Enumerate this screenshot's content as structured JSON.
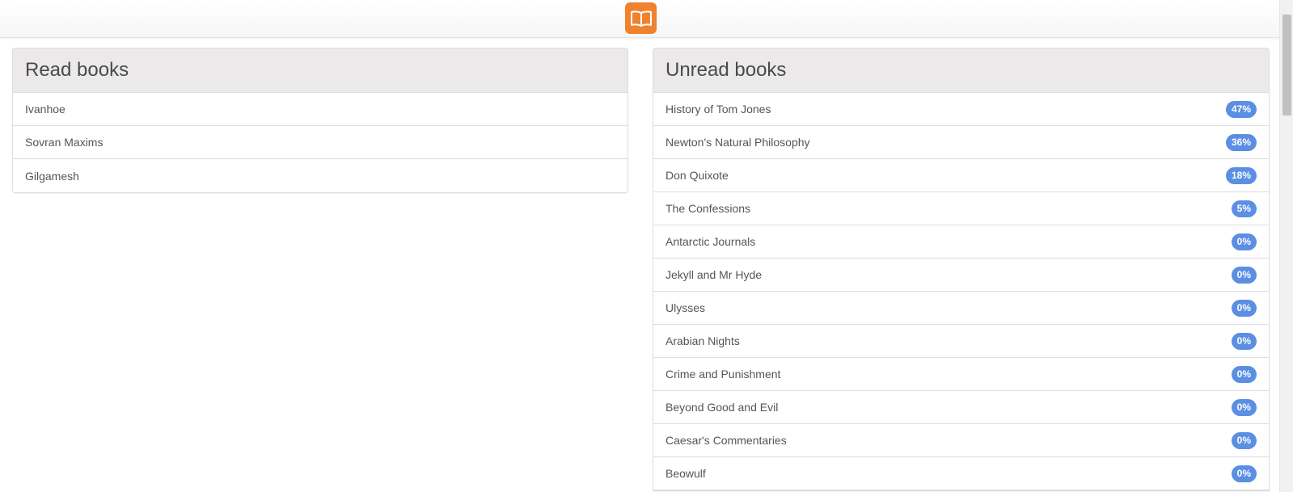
{
  "app": {
    "logo_icon": "open-book-icon",
    "accent_color": "#f0822d"
  },
  "read_panel": {
    "title": "Read books",
    "items": [
      {
        "label": "Ivanhoe"
      },
      {
        "label": "Sovran Maxims"
      },
      {
        "label": "Gilgamesh"
      }
    ]
  },
  "unread_panel": {
    "title": "Unread books",
    "badge_color": "#5b8fe3",
    "items": [
      {
        "label": "History of Tom Jones",
        "progress": "47%"
      },
      {
        "label": "Newton's Natural Philosophy",
        "progress": "36%"
      },
      {
        "label": "Don Quixote",
        "progress": "18%"
      },
      {
        "label": "The Confessions",
        "progress": "5%"
      },
      {
        "label": "Antarctic Journals",
        "progress": "0%"
      },
      {
        "label": "Jekyll and Mr Hyde",
        "progress": "0%"
      },
      {
        "label": "Ulysses",
        "progress": "0%"
      },
      {
        "label": "Arabian Nights",
        "progress": "0%"
      },
      {
        "label": "Crime and Punishment",
        "progress": "0%"
      },
      {
        "label": "Beyond Good and Evil",
        "progress": "0%"
      },
      {
        "label": "Caesar's Commentaries",
        "progress": "0%"
      },
      {
        "label": "Beowulf",
        "progress": "0%"
      }
    ]
  }
}
